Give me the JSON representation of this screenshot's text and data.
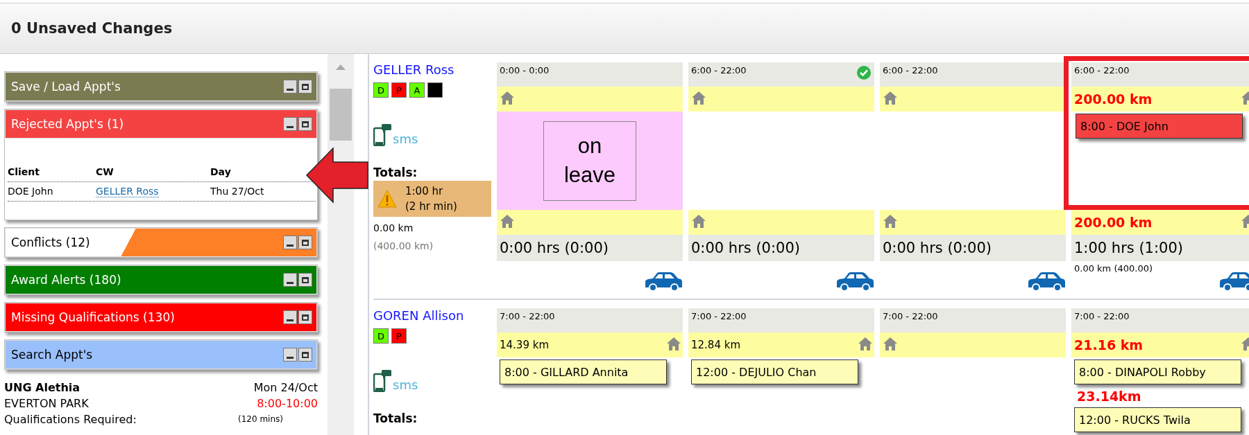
{
  "header": {
    "title": "0 Unsaved Changes"
  },
  "panels": [
    {
      "kind": "save",
      "title": "Save / Load Appt's",
      "color": "#7b7b52"
    },
    {
      "kind": "rejected",
      "title": "Rejected Appt's (1)",
      "color": "#f44242",
      "table": {
        "columns": [
          "Client",
          "CW",
          "Day"
        ],
        "rows": [
          {
            "client": "DOE John",
            "cw": "GELLER Ross",
            "day": "Thu 27/Oct"
          }
        ]
      }
    },
    {
      "kind": "conflicts",
      "title": "Conflicts (12)",
      "color": "#fd7f26"
    },
    {
      "kind": "award",
      "title": "Award Alerts (180)",
      "color": "#007f00"
    },
    {
      "kind": "missing",
      "title": "Missing Qualifications (130)",
      "color": "#fe0000"
    },
    {
      "kind": "search",
      "title": "Search Appt's",
      "color": "#9ac0fb"
    }
  ],
  "appointment_info": {
    "client": "UNG Alethia",
    "date": "Mon 24/Oct",
    "suburb": "EVERTON PARK",
    "time": "8:00-10:00",
    "qualifications_label": "Qualifications Required:",
    "duration": "(120 mins)"
  },
  "workers": [
    {
      "name": "GELLER Ross",
      "badges": [
        {
          "label": "D",
          "color": "#66ff00"
        },
        {
          "label": "P",
          "color": "#ff0000"
        },
        {
          "label": "A",
          "color": "#66ff00"
        },
        {
          "color": "#000000"
        }
      ],
      "sms": "sms",
      "totals_label": "Totals:",
      "hours": "1:00 hr",
      "minimum": "(2 hr min)",
      "warning": true,
      "km": "0.00 km",
      "max_km": "(400.00 km)",
      "days": [
        {
          "time": "0:00 - 0:00",
          "on_leave": true,
          "leave_text": "on leave",
          "hours": "0:00 hrs (0:00)"
        },
        {
          "time": "6:00 - 22:00",
          "approved": true,
          "hours": "0:00 hrs (0:00)"
        },
        {
          "time": "6:00 - 22:00",
          "hours": "0:00 hrs (0:00)"
        },
        {
          "time": "6:00 - 22:00",
          "highlighted": true,
          "km_top": "200.00 km",
          "appointments": [
            {
              "kind": "rejected",
              "text": "8:00 - DOE John"
            }
          ],
          "km_bottom": "200.00 km",
          "hours": "1:00 hrs (1:00)",
          "travel_km": "0.00 km (400.00)"
        }
      ]
    },
    {
      "name": "GOREN Allison",
      "badges": [
        {
          "label": "D",
          "color": "#66ff00"
        },
        {
          "label": "P",
          "color": "#ff0000"
        }
      ],
      "sms": "sms",
      "totals_label": "Totals:",
      "days": [
        {
          "time": "7:00 - 22:00",
          "km_top": "14.39 km",
          "appointments": [
            {
              "kind": "normal",
              "text": "8:00 - GILLARD Annita"
            }
          ]
        },
        {
          "time": "7:00 - 22:00",
          "km_top": "12.84 km",
          "appointments": [
            {
              "kind": "normal",
              "text": "12:00 - DEJULIO Chan"
            }
          ]
        },
        {
          "time": "7:00 - 22:00"
        },
        {
          "time": "7:00 - 22:00",
          "km_top": "21.16 km",
          "km_top_alert": true,
          "appointments": [
            {
              "kind": "normal",
              "text": "8:00 - DINAPOLI Robby"
            },
            {
              "kind": "normal",
              "km_before": "23.14km",
              "text": "12:00 - RUCKS Twila"
            }
          ]
        }
      ]
    }
  ]
}
